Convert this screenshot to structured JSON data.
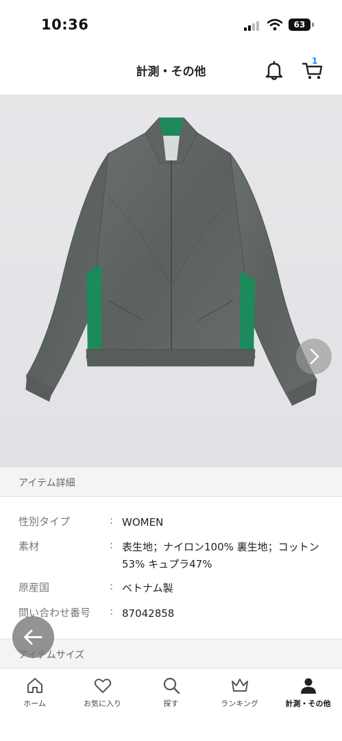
{
  "status_bar": {
    "time": "10:36",
    "battery": "63"
  },
  "header": {
    "title": "計測・その他",
    "cart_count": "1"
  },
  "hero": {
    "product_image": "green and gray track jacket photo"
  },
  "details_section": {
    "title": "アイテム詳細"
  },
  "details": [
    {
      "label": "性別タイプ",
      "sep": ":",
      "value": "WOMEN"
    },
    {
      "label": "素材",
      "sep": ":",
      "value": "表生地；ナイロン100% 裏生地；コットン53% キュプラ47%"
    },
    {
      "label": "原産国",
      "sep": ":",
      "value": "ベトナム製"
    },
    {
      "label": "問い合わせ番号",
      "sep": ":",
      "value": "87042858"
    }
  ],
  "size_section": {
    "title": "アイテムサイズ"
  },
  "tabbar": [
    {
      "label": "ホーム",
      "icon": "home-icon"
    },
    {
      "label": "お気に入り",
      "icon": "heart-icon"
    },
    {
      "label": "探す",
      "icon": "search-icon"
    },
    {
      "label": "ランキング",
      "icon": "crown-icon"
    },
    {
      "label": "計測・その他",
      "icon": "person-icon",
      "active": true
    }
  ],
  "colors": {
    "jacket_gray": "#5f6663",
    "accent_green": "#1c8a5a",
    "badge_blue": "#1e88e5"
  }
}
